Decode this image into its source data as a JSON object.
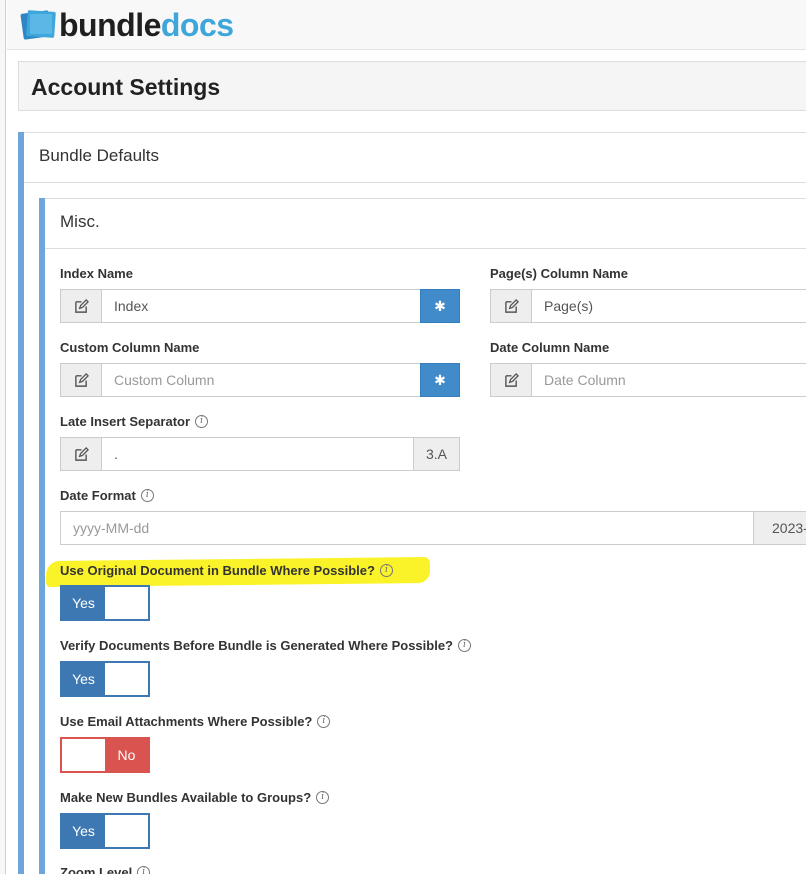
{
  "brand": {
    "name_part1": "bundle",
    "name_part2": "docs"
  },
  "page": {
    "title": "Account Settings"
  },
  "sections": {
    "bundle_defaults": "Bundle Defaults",
    "misc": "Misc."
  },
  "fields": {
    "index_name": {
      "label": "Index Name",
      "value": "Index"
    },
    "pages_column_name": {
      "label": "Page(s) Column Name",
      "value": "Page(s)"
    },
    "custom_column_name": {
      "label": "Custom Column Name",
      "placeholder": "Custom Column"
    },
    "date_column_name": {
      "label": "Date Column Name",
      "placeholder": "Date Column"
    },
    "late_insert_separator": {
      "label": "Late Insert Separator",
      "value": ".",
      "preview": "3.A"
    },
    "date_format": {
      "label": "Date Format",
      "placeholder": "yyyy-MM-dd",
      "preview": "2023-"
    }
  },
  "toggles": {
    "use_original": {
      "label": "Use Original Document in Bundle Where Possible?",
      "state": "Yes"
    },
    "verify_documents": {
      "label": "Verify Documents Before Bundle is Generated Where Possible?",
      "state": "Yes"
    },
    "email_attachments": {
      "label": "Use Email Attachments Where Possible?",
      "state": "No"
    },
    "available_to_groups": {
      "label": "Make New Bundles Available to Groups?",
      "state": "Yes"
    }
  },
  "zoom_level": {
    "label": "Zoom Level"
  },
  "icons": {
    "edit": "pencil-square-icon",
    "asterisk": "asterisk-icon",
    "info": "info-circle-icon"
  },
  "colors": {
    "brand_dark": "#1f1f1f",
    "brand_blue": "#3ea6da",
    "accent": "#6fa6d9",
    "toggle_yes": "#3d78b3",
    "toggle_no": "#d9534f",
    "button_blue": "#428bca",
    "highlight": "#fbf32a"
  }
}
